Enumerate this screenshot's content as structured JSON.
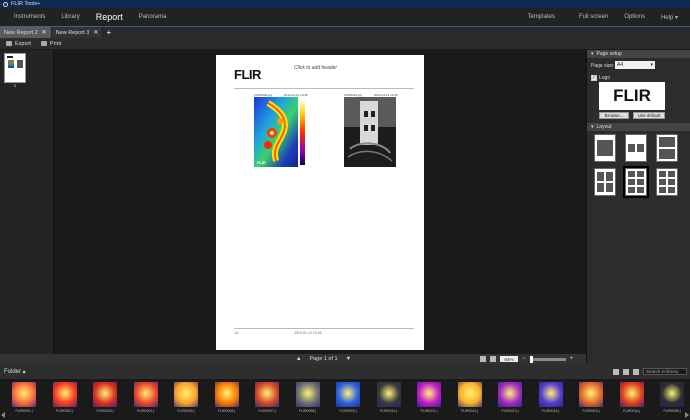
{
  "app": {
    "title": "FLIR Tools+"
  },
  "menu": {
    "items": [
      "Instruments",
      "Library",
      "Report",
      "Panorama"
    ],
    "active": "Report",
    "right": [
      "Templates",
      "Full screen",
      "Options",
      "Help ▾"
    ]
  },
  "tabs": [
    {
      "label": "New Report 2",
      "active": true
    },
    {
      "label": "New Report 3",
      "active": false
    }
  ],
  "toolbar": {
    "export_label": "Export",
    "print_label": "Print"
  },
  "thumbnails": {
    "page_number": "1"
  },
  "report": {
    "logo_text": "FLIR",
    "header_hint": "Click to add header",
    "ir_caption_left": "FLIR0000.jpg",
    "ir_caption_right": "2013-01-12 10:35",
    "photo_caption_left": "FLIR0001.jpg",
    "photo_caption_right": "2013-01-12 10:36",
    "footer_left": "1/1",
    "footer_mid": "2013-01-12 10:40"
  },
  "status": {
    "page_label": "Page 1 of 1",
    "zoom": "64%"
  },
  "page_setup": {
    "title": "Page setup",
    "page_size_label": "Page size:",
    "page_size_value": "A4",
    "logo_label": "Logo",
    "logo_checked": true,
    "logo_text": "FLIR",
    "browse_label": "Browse...",
    "default_label": "Use default"
  },
  "layout": {
    "title": "Layout",
    "selected": 4
  },
  "folder": {
    "label": "Folder ▴",
    "search_placeholder": "Search in library"
  },
  "filmstrip": [
    {
      "name": "FLIR0001.j",
      "color": "#ff6a3a"
    },
    {
      "name": "FLIR0002.j",
      "color": "#ff3b1e"
    },
    {
      "name": "FLIR0003.j",
      "color": "#e0301c"
    },
    {
      "name": "FLIR0004.j",
      "color": "#f0452a"
    },
    {
      "name": "FLIR0005.j",
      "color": "#ffa22a"
    },
    {
      "name": "FLIR0006.j",
      "color": "#ff7a00"
    },
    {
      "name": "FLIR0007.j",
      "color": "#d7472a"
    },
    {
      "name": "FLIR0008.j",
      "color": "#707070"
    },
    {
      "name": "FLIR0009.j",
      "color": "#2e62e0"
    },
    {
      "name": "FLIR0010.j",
      "color": "#3a3a3a"
    },
    {
      "name": "FLIR0011.j",
      "color": "#c31cc9"
    },
    {
      "name": "FLIR0012.j",
      "color": "#ffb12a"
    },
    {
      "name": "FLIR0013.j",
      "color": "#a22ac3"
    },
    {
      "name": "FLIR0014.j",
      "color": "#5a3ad0"
    },
    {
      "name": "FLIR0015.j",
      "color": "#e5682a"
    },
    {
      "name": "FLIR0016.j",
      "color": "#e23c1a"
    },
    {
      "name": "FLIR0055.j",
      "color": "#2d2d2d"
    }
  ]
}
